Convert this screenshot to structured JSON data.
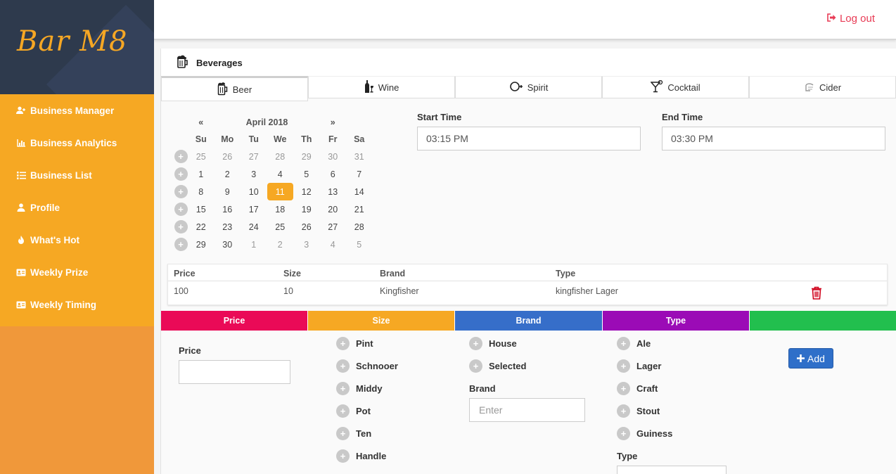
{
  "brand": {
    "logo": "Bar M8"
  },
  "sidebar": {
    "items": [
      {
        "label": "Business Manager",
        "icon": "user-plus-icon"
      },
      {
        "label": "Business Analytics",
        "icon": "bar-chart-icon"
      },
      {
        "label": "Business List",
        "icon": "list-icon"
      },
      {
        "label": "Profile",
        "icon": "user-icon"
      },
      {
        "label": "What's Hot",
        "icon": "fire-icon"
      },
      {
        "label": "Weekly Prize",
        "icon": "id-card-icon"
      },
      {
        "label": "Weekly Timing",
        "icon": "id-card-icon"
      }
    ]
  },
  "topbar": {
    "logout_label": "Log out"
  },
  "card": {
    "title": "Beverages"
  },
  "tabs": [
    {
      "label": "Beer",
      "icon": "beer-mug-icon",
      "active": true
    },
    {
      "label": "Wine",
      "icon": "wine-bottle-icon",
      "active": false
    },
    {
      "label": "Spirit",
      "icon": "spirit-icon",
      "active": false
    },
    {
      "label": "Cocktail",
      "icon": "cocktail-glass-icon",
      "active": false
    },
    {
      "label": "Cider",
      "icon": "cider-icon",
      "active": false
    }
  ],
  "calendar": {
    "prev": "«",
    "next": "»",
    "month_label": "April 2018",
    "weekdays": [
      "Su",
      "Mo",
      "Tu",
      "We",
      "Th",
      "Fr",
      "Sa"
    ],
    "weeks": [
      [
        "25",
        "26",
        "27",
        "28",
        "29",
        "30",
        "31"
      ],
      [
        "1",
        "2",
        "3",
        "4",
        "5",
        "6",
        "7"
      ],
      [
        "8",
        "9",
        "10",
        "11",
        "12",
        "13",
        "14"
      ],
      [
        "15",
        "16",
        "17",
        "18",
        "19",
        "20",
        "21"
      ],
      [
        "22",
        "23",
        "24",
        "25",
        "26",
        "27",
        "28"
      ],
      [
        "29",
        "30",
        "1",
        "2",
        "3",
        "4",
        "5"
      ]
    ],
    "selected": "11"
  },
  "start_time": {
    "label": "Start Time",
    "value": "03:15 PM"
  },
  "end_time": {
    "label": "End Time",
    "value": "03:30 PM"
  },
  "table": {
    "headers": [
      "Price",
      "Size",
      "Brand",
      "Type"
    ],
    "rows": [
      {
        "price": "100",
        "size": "10",
        "brand": "Kingfisher",
        "type": "kingfisher Lager"
      }
    ]
  },
  "color_bar": [
    {
      "label": "Price",
      "color": "#ea0a57"
    },
    {
      "label": "Size",
      "color": "#f6a823"
    },
    {
      "label": "Brand",
      "color": "#366ec9"
    },
    {
      "label": "Type",
      "color": "#9b0bb6"
    },
    {
      "label": "",
      "color": "#22bf4e"
    }
  ],
  "form": {
    "price_label": "Price",
    "price_value": "",
    "sizes": [
      "Pint",
      "Schnooer",
      "Middy",
      "Pot",
      "Ten",
      "Handle"
    ],
    "brand_options": [
      "House",
      "Selected"
    ],
    "brand_label": "Brand",
    "brand_placeholder": "Enter",
    "types": [
      "Ale",
      "Lager",
      "Craft",
      "Stout",
      "Guiness"
    ],
    "type_label": "Type",
    "add_label": "Add"
  }
}
